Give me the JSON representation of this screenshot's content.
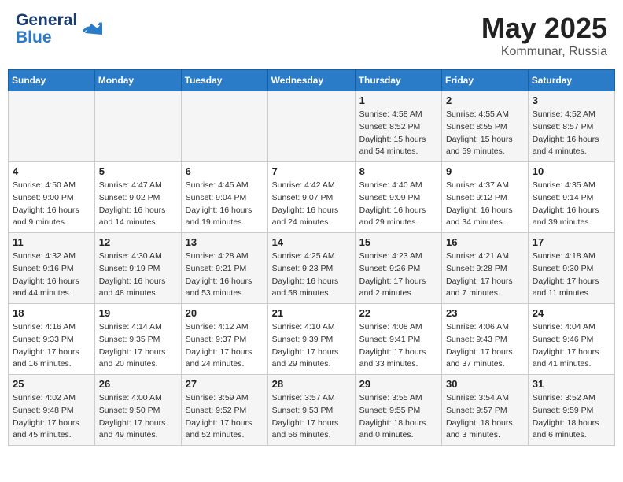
{
  "header": {
    "logo_line1": "General",
    "logo_line2": "Blue",
    "month": "May 2025",
    "location": "Kommunar, Russia"
  },
  "weekdays": [
    "Sunday",
    "Monday",
    "Tuesday",
    "Wednesday",
    "Thursday",
    "Friday",
    "Saturday"
  ],
  "weeks": [
    [
      {
        "day": "",
        "info": ""
      },
      {
        "day": "",
        "info": ""
      },
      {
        "day": "",
        "info": ""
      },
      {
        "day": "",
        "info": ""
      },
      {
        "day": "1",
        "info": "Sunrise: 4:58 AM\nSunset: 8:52 PM\nDaylight: 15 hours\nand 54 minutes."
      },
      {
        "day": "2",
        "info": "Sunrise: 4:55 AM\nSunset: 8:55 PM\nDaylight: 15 hours\nand 59 minutes."
      },
      {
        "day": "3",
        "info": "Sunrise: 4:52 AM\nSunset: 8:57 PM\nDaylight: 16 hours\nand 4 minutes."
      }
    ],
    [
      {
        "day": "4",
        "info": "Sunrise: 4:50 AM\nSunset: 9:00 PM\nDaylight: 16 hours\nand 9 minutes."
      },
      {
        "day": "5",
        "info": "Sunrise: 4:47 AM\nSunset: 9:02 PM\nDaylight: 16 hours\nand 14 minutes."
      },
      {
        "day": "6",
        "info": "Sunrise: 4:45 AM\nSunset: 9:04 PM\nDaylight: 16 hours\nand 19 minutes."
      },
      {
        "day": "7",
        "info": "Sunrise: 4:42 AM\nSunset: 9:07 PM\nDaylight: 16 hours\nand 24 minutes."
      },
      {
        "day": "8",
        "info": "Sunrise: 4:40 AM\nSunset: 9:09 PM\nDaylight: 16 hours\nand 29 minutes."
      },
      {
        "day": "9",
        "info": "Sunrise: 4:37 AM\nSunset: 9:12 PM\nDaylight: 16 hours\nand 34 minutes."
      },
      {
        "day": "10",
        "info": "Sunrise: 4:35 AM\nSunset: 9:14 PM\nDaylight: 16 hours\nand 39 minutes."
      }
    ],
    [
      {
        "day": "11",
        "info": "Sunrise: 4:32 AM\nSunset: 9:16 PM\nDaylight: 16 hours\nand 44 minutes."
      },
      {
        "day": "12",
        "info": "Sunrise: 4:30 AM\nSunset: 9:19 PM\nDaylight: 16 hours\nand 48 minutes."
      },
      {
        "day": "13",
        "info": "Sunrise: 4:28 AM\nSunset: 9:21 PM\nDaylight: 16 hours\nand 53 minutes."
      },
      {
        "day": "14",
        "info": "Sunrise: 4:25 AM\nSunset: 9:23 PM\nDaylight: 16 hours\nand 58 minutes."
      },
      {
        "day": "15",
        "info": "Sunrise: 4:23 AM\nSunset: 9:26 PM\nDaylight: 17 hours\nand 2 minutes."
      },
      {
        "day": "16",
        "info": "Sunrise: 4:21 AM\nSunset: 9:28 PM\nDaylight: 17 hours\nand 7 minutes."
      },
      {
        "day": "17",
        "info": "Sunrise: 4:18 AM\nSunset: 9:30 PM\nDaylight: 17 hours\nand 11 minutes."
      }
    ],
    [
      {
        "day": "18",
        "info": "Sunrise: 4:16 AM\nSunset: 9:33 PM\nDaylight: 17 hours\nand 16 minutes."
      },
      {
        "day": "19",
        "info": "Sunrise: 4:14 AM\nSunset: 9:35 PM\nDaylight: 17 hours\nand 20 minutes."
      },
      {
        "day": "20",
        "info": "Sunrise: 4:12 AM\nSunset: 9:37 PM\nDaylight: 17 hours\nand 24 minutes."
      },
      {
        "day": "21",
        "info": "Sunrise: 4:10 AM\nSunset: 9:39 PM\nDaylight: 17 hours\nand 29 minutes."
      },
      {
        "day": "22",
        "info": "Sunrise: 4:08 AM\nSunset: 9:41 PM\nDaylight: 17 hours\nand 33 minutes."
      },
      {
        "day": "23",
        "info": "Sunrise: 4:06 AM\nSunset: 9:43 PM\nDaylight: 17 hours\nand 37 minutes."
      },
      {
        "day": "24",
        "info": "Sunrise: 4:04 AM\nSunset: 9:46 PM\nDaylight: 17 hours\nand 41 minutes."
      }
    ],
    [
      {
        "day": "25",
        "info": "Sunrise: 4:02 AM\nSunset: 9:48 PM\nDaylight: 17 hours\nand 45 minutes."
      },
      {
        "day": "26",
        "info": "Sunrise: 4:00 AM\nSunset: 9:50 PM\nDaylight: 17 hours\nand 49 minutes."
      },
      {
        "day": "27",
        "info": "Sunrise: 3:59 AM\nSunset: 9:52 PM\nDaylight: 17 hours\nand 52 minutes."
      },
      {
        "day": "28",
        "info": "Sunrise: 3:57 AM\nSunset: 9:53 PM\nDaylight: 17 hours\nand 56 minutes."
      },
      {
        "day": "29",
        "info": "Sunrise: 3:55 AM\nSunset: 9:55 PM\nDaylight: 18 hours\nand 0 minutes."
      },
      {
        "day": "30",
        "info": "Sunrise: 3:54 AM\nSunset: 9:57 PM\nDaylight: 18 hours\nand 3 minutes."
      },
      {
        "day": "31",
        "info": "Sunrise: 3:52 AM\nSunset: 9:59 PM\nDaylight: 18 hours\nand 6 minutes."
      }
    ]
  ]
}
